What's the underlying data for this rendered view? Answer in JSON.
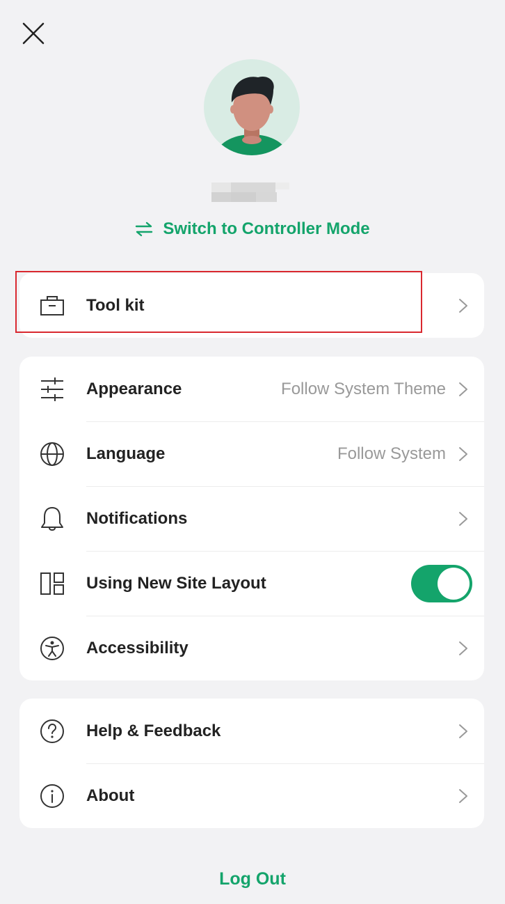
{
  "header": {
    "close_icon": "close-icon",
    "avatar_icon": "user-avatar-illustration",
    "switch_mode_label": "Switch to Controller Mode",
    "switch_mode_icon": "swap-arrows-icon"
  },
  "toolkit_card": {
    "label": "Tool kit",
    "icon": "toolbox-icon"
  },
  "settings_card": {
    "appearance": {
      "label": "Appearance",
      "value": "Follow System Theme",
      "icon": "sliders-icon"
    },
    "language": {
      "label": "Language",
      "value": "Follow System",
      "icon": "globe-icon"
    },
    "notifications": {
      "label": "Notifications",
      "icon": "bell-icon"
    },
    "new_site_layout": {
      "label": "Using New Site Layout",
      "icon": "layout-icon",
      "enabled": true
    },
    "accessibility": {
      "label": "Accessibility",
      "icon": "accessibility-icon"
    }
  },
  "support_card": {
    "help": {
      "label": "Help & Feedback",
      "icon": "question-circle-icon"
    },
    "about": {
      "label": "About",
      "icon": "info-circle-icon"
    }
  },
  "footer": {
    "logout_label": "Log Out"
  },
  "colors": {
    "accent": "#14a46b",
    "background": "#f2f2f4",
    "highlight": "#d9282f"
  }
}
